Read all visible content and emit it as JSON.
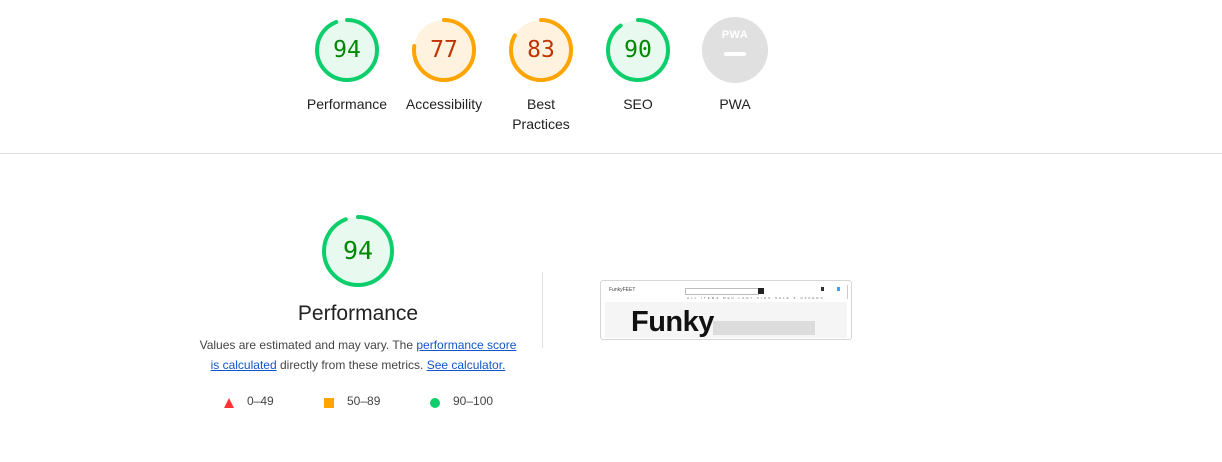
{
  "gauges": [
    {
      "score": "94",
      "label": "Performance",
      "value": 0.94,
      "color": "#0cce6b",
      "fill": "#e8faf0",
      "text_color": "#008800"
    },
    {
      "score": "77",
      "label": "Accessibility",
      "value": 0.77,
      "color": "#ffa400",
      "fill": "#fff3e0",
      "text_color": "#c33300"
    },
    {
      "score": "83",
      "label_line1": "Best",
      "label_line2": "Practices",
      "value": 0.83,
      "color": "#ffa400",
      "fill": "#fff3e0",
      "text_color": "#c33300"
    },
    {
      "score": "90",
      "label": "SEO",
      "value": 0.9,
      "color": "#0cce6b",
      "fill": "#e8faf0",
      "text_color": "#008800"
    },
    {
      "badge_text": "PWA",
      "label": "PWA",
      "color": "#e0e0e0"
    }
  ],
  "performance": {
    "score": "94",
    "value": 0.94,
    "title": "Performance",
    "desc_part1": "Values are estimated and may vary. The ",
    "link_perf_score": "performance score is calculated",
    "desc_part2": " directly from these metrics. ",
    "link_calculator": "See calculator."
  },
  "legend": [
    {
      "range": "0–49",
      "shape": "triangle",
      "color": "#ff3333"
    },
    {
      "range": "50–89",
      "shape": "square",
      "color": "#ffa400"
    },
    {
      "range": "90–100",
      "shape": "circle",
      "color": "#0cce6b"
    }
  ],
  "thumbnail": {
    "brand": "FunkyFEET",
    "nav": "ALL ITEMS MEN LADY KIDS SALE & OFFERS",
    "hero": "Funky"
  }
}
